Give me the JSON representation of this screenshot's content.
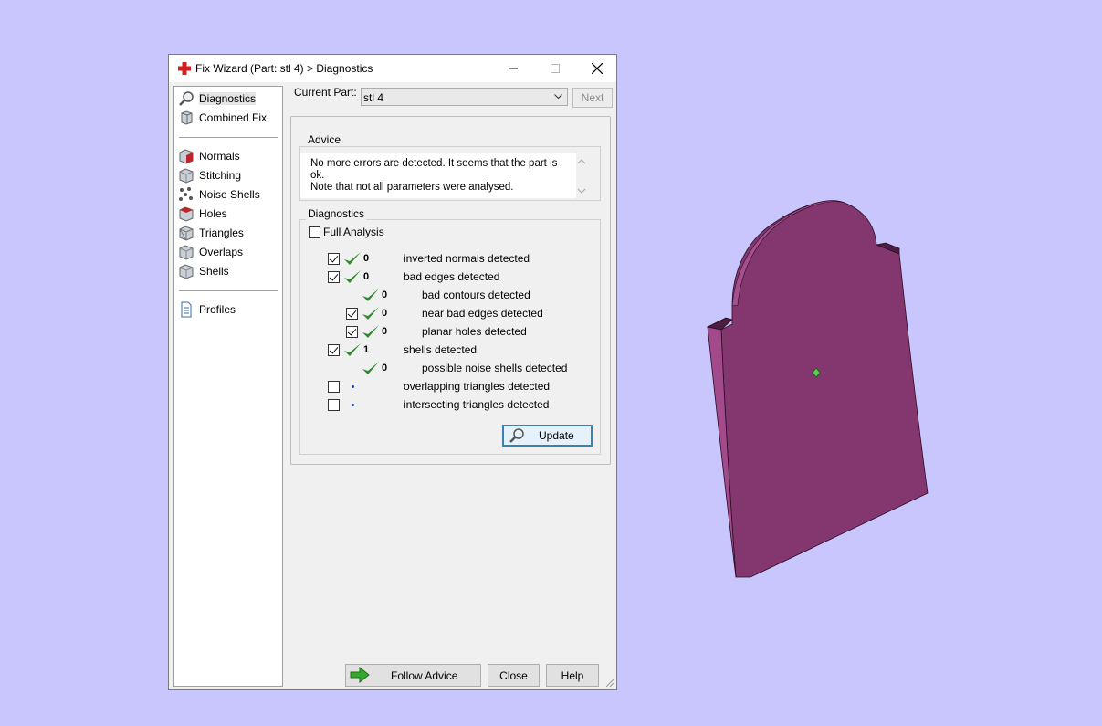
{
  "window": {
    "title": "Fix Wizard (Part: stl 4) > Diagnostics"
  },
  "nav": {
    "items": [
      {
        "label": "Diagnostics",
        "icon": "magnifier-icon",
        "selected": true
      },
      {
        "label": "Combined Fix",
        "icon": "combined-fix-icon"
      },
      {
        "label": "Normals",
        "icon": "normals-cube-icon"
      },
      {
        "label": "Stitching",
        "icon": "stitching-cube-icon"
      },
      {
        "label": "Noise Shells",
        "icon": "noise-shells-cube-icon"
      },
      {
        "label": "Holes",
        "icon": "holes-cube-icon"
      },
      {
        "label": "Triangles",
        "icon": "triangles-cube-icon"
      },
      {
        "label": "Overlaps",
        "icon": "overlaps-cube-icon"
      },
      {
        "label": "Shells",
        "icon": "shells-cube-icon"
      },
      {
        "label": "Profiles",
        "icon": "document-icon"
      }
    ]
  },
  "current_part": {
    "label": "Current Part:",
    "value": "stl 4",
    "next_label": "Next"
  },
  "advice": {
    "title": "Advice",
    "text_line1": "No more errors are detected. It seems that the part is ok.",
    "text_line2": "Note that not all parameters were analysed."
  },
  "diagnostics": {
    "title": "Diagnostics",
    "full_analysis_label": "Full Analysis",
    "rows": [
      {
        "checkbox": true,
        "checked": true,
        "status": "ok",
        "count": "0",
        "label": "inverted normals detected",
        "indent": 0
      },
      {
        "checkbox": true,
        "checked": true,
        "status": "ok",
        "count": "0",
        "label": "bad edges detected",
        "indent": 0
      },
      {
        "checkbox": false,
        "checked": false,
        "status": "ok",
        "count": "0",
        "label": "bad contours detected",
        "indent": 1
      },
      {
        "checkbox": true,
        "checked": true,
        "status": "ok",
        "count": "0",
        "label": "near bad edges detected",
        "indent": 1
      },
      {
        "checkbox": true,
        "checked": true,
        "status": "ok",
        "count": "0",
        "label": "planar holes detected",
        "indent": 1
      },
      {
        "checkbox": true,
        "checked": true,
        "status": "ok",
        "count": "1",
        "label": "shells detected",
        "indent": 0
      },
      {
        "checkbox": false,
        "checked": false,
        "status": "ok",
        "count": "0",
        "label": "possible noise shells detected",
        "indent": 1
      },
      {
        "checkbox": true,
        "checked": false,
        "status": "pending",
        "count": "",
        "label": "overlapping triangles detected",
        "indent": 0
      },
      {
        "checkbox": true,
        "checked": false,
        "status": "pending",
        "count": "",
        "label": "intersecting triangles detected",
        "indent": 0
      }
    ],
    "update_label": "Update"
  },
  "buttons": {
    "follow_advice": "Follow Advice",
    "close": "Close",
    "help": "Help"
  },
  "colors": {
    "desktop_background": "#c8c6fc",
    "model_face": "#84376f",
    "check_green": "#2e8b2e"
  }
}
